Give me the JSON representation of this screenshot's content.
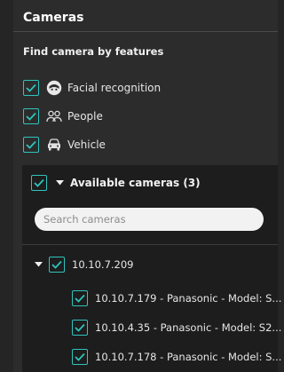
{
  "header": {
    "title": "Cameras"
  },
  "features": {
    "section_label": "Find camera by features",
    "items": [
      {
        "label": "Facial recognition",
        "checked": true,
        "icon": "face-icon"
      },
      {
        "label": "People",
        "checked": true,
        "icon": "people-icon"
      },
      {
        "label": "Vehicle",
        "checked": true,
        "icon": "vehicle-icon"
      }
    ]
  },
  "available": {
    "title": "Available cameras (3)",
    "checked": true,
    "expanded": true,
    "search_placeholder": "Search cameras",
    "tree": {
      "server": "10.10.7.209",
      "cameras": [
        {
          "label": "10.10.7.179 - Panasonic - Model: S..."
        },
        {
          "label": "10.10.4.35 - Panasonic - Model: S2..."
        },
        {
          "label": "10.10.7.178 - Panasonic - Model: S..."
        }
      ]
    }
  },
  "colors": {
    "accent": "#2fc4bc",
    "panel_bg": "#2c2c2c",
    "group_bg": "#1d1d1d"
  }
}
